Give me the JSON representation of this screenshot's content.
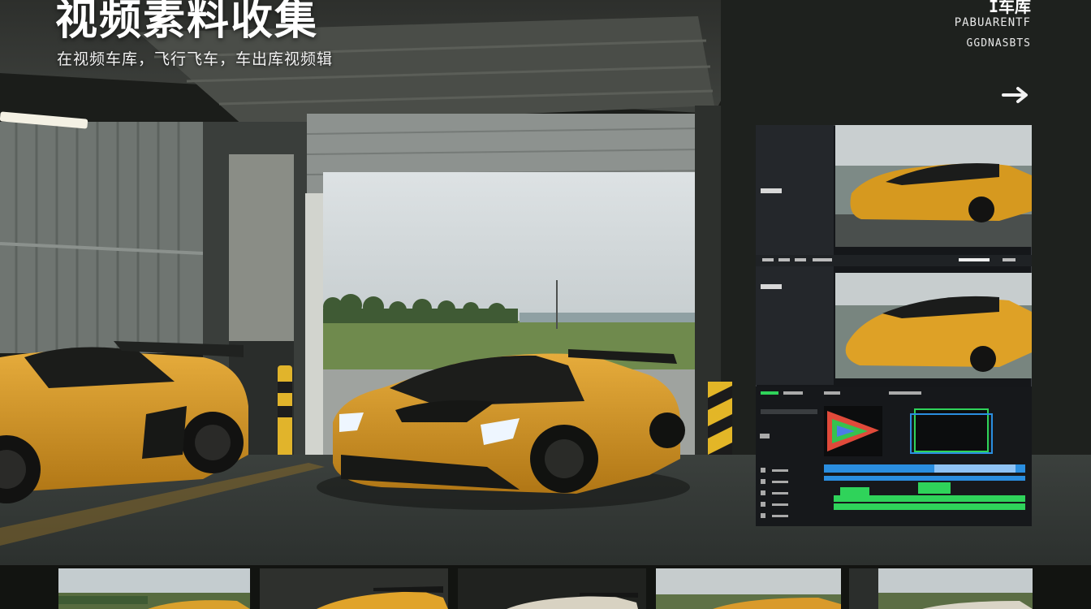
{
  "header": {
    "title": "视频素料收集",
    "subtitle": "在视频车库，飞行飞车，车出库视频辑"
  },
  "corner": {
    "top": "I车库",
    "line1": "PABUARENTF",
    "line2": "GGDNASBTS"
  },
  "colors": {
    "car": "#d99a2b",
    "accent_green": "#2fd35a",
    "accent_blue": "#2a8ee0",
    "panel_bg": "#15171a"
  },
  "icons": [
    "arrow-right-icon",
    "play-icon"
  ]
}
